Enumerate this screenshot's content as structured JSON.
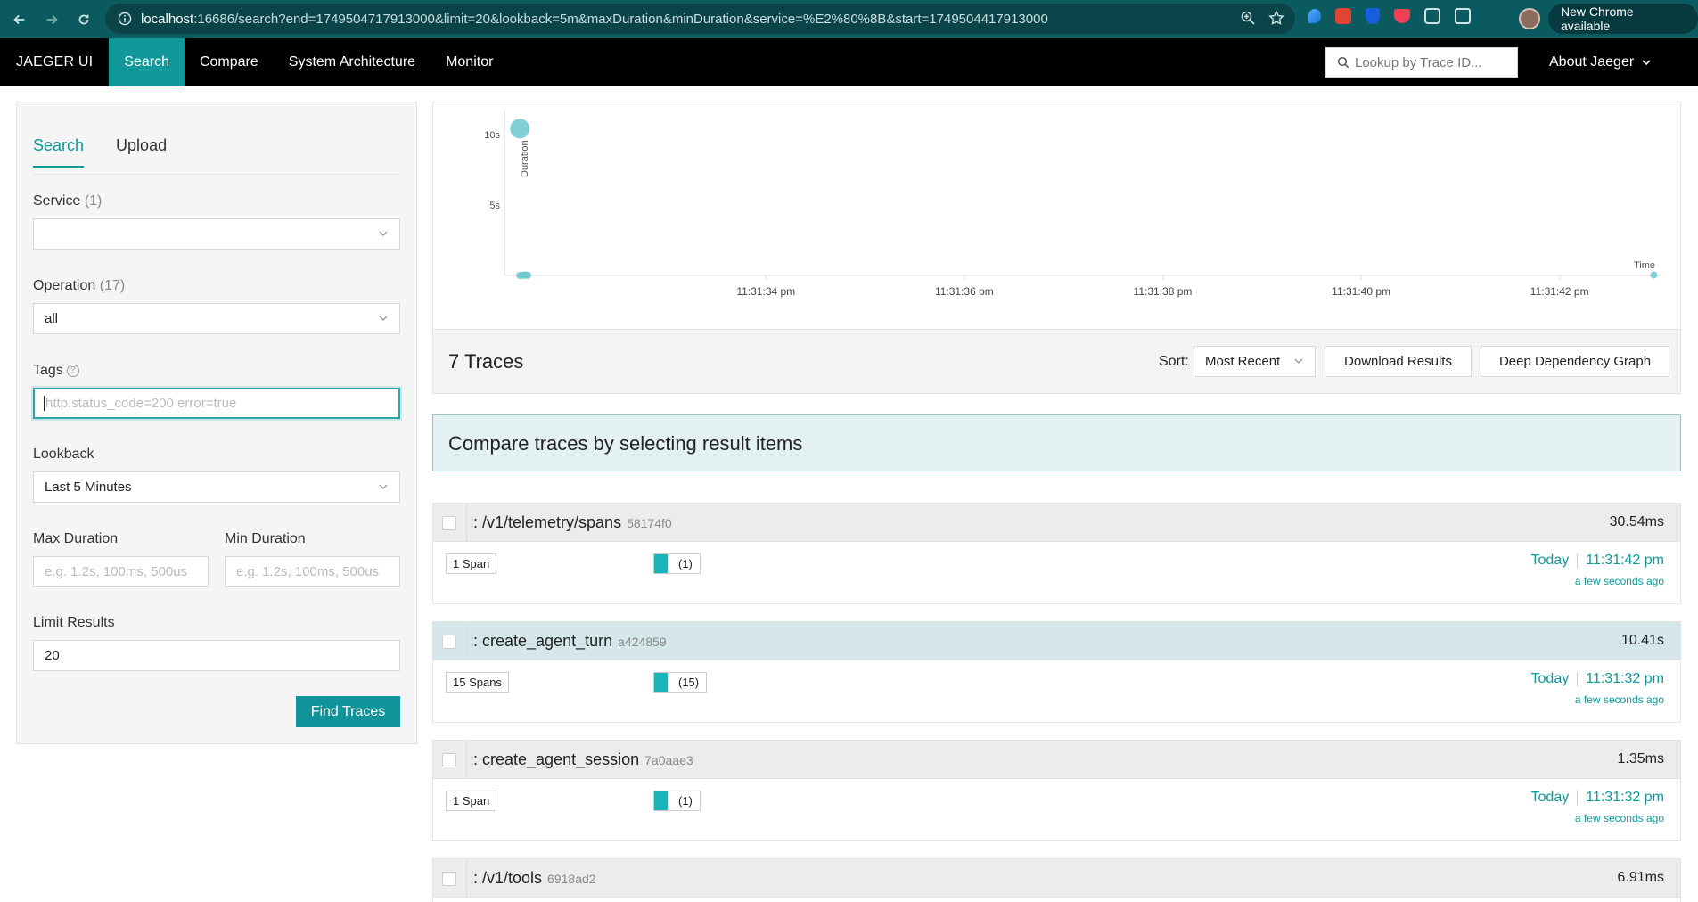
{
  "browser": {
    "url_host": "localhost",
    "url_rest": ":16686/search?end=1749504717913000&limit=20&lookback=5m&maxDuration&minDuration&service=%E2%80%8B&start=1749504417913000",
    "new_chrome": "New Chrome available"
  },
  "nav": {
    "brand": "JAEGER UI",
    "items": [
      "Search",
      "Compare",
      "System Architecture",
      "Monitor"
    ],
    "lookup_placeholder": "Lookup by Trace ID...",
    "about": "About Jaeger"
  },
  "search_form": {
    "tabs": [
      "Search",
      "Upload"
    ],
    "service_label": "Service",
    "service_count": "(1)",
    "service_value": "",
    "operation_label": "Operation",
    "operation_count": "(17)",
    "operation_value": "all",
    "tags_label": "Tags",
    "tags_placeholder": "http.status_code=200 error=true",
    "lookback_label": "Lookback",
    "lookback_value": "Last 5 Minutes",
    "max_duration_label": "Max Duration",
    "max_duration_placeholder": "e.g. 1.2s, 100ms, 500us",
    "min_duration_label": "Min Duration",
    "min_duration_placeholder": "e.g. 1.2s, 100ms, 500us",
    "limit_label": "Limit Results",
    "limit_value": "20",
    "find_button": "Find Traces"
  },
  "chart_data": {
    "type": "scatter",
    "ylabel": "Duration",
    "xlabel": "Time",
    "y_ticks": [
      "5s",
      "10s"
    ],
    "x_ticks": [
      "11:31:34 pm",
      "11:31:36 pm",
      "11:31:38 pm",
      "11:31:40 pm",
      "11:31:42 pm"
    ],
    "x_tick_values": [
      34,
      36,
      38,
      40,
      42
    ],
    "xlim": [
      31.5,
      43
    ],
    "ylim": [
      0,
      11
    ],
    "points": [
      {
        "x": 31.52,
        "y": 10.41
      },
      {
        "x": 31.52,
        "y": 0.00135
      },
      {
        "x": 31.55,
        "y": 0.00691
      },
      {
        "x": 31.56,
        "y": 0.02
      },
      {
        "x": 31.58,
        "y": 0.03
      },
      {
        "x": 31.6,
        "y": 0.01
      },
      {
        "x": 42.95,
        "y": 0.03054
      }
    ],
    "color": "#6cc8cc"
  },
  "results": {
    "count_label": "7 Traces",
    "sort_label": "Sort:",
    "sort_value": "Most Recent",
    "download_button": "Download Results",
    "ddg_button": "Deep Dependency Graph",
    "compare_banner": "Compare traces by selecting result items"
  },
  "traces": [
    {
      "title": ": /v1/telemetry/spans",
      "id": "58174f0",
      "duration": "30.54ms",
      "spans": "1 Span",
      "svc_count": "(1)",
      "day": "Today",
      "time": "11:31:42 pm",
      "ago": "a few seconds ago",
      "highlight": false
    },
    {
      "title": ": create_agent_turn",
      "id": "a424859",
      "duration": "10.41s",
      "spans": "15 Spans",
      "svc_count": "(15)",
      "day": "Today",
      "time": "11:31:32 pm",
      "ago": "a few seconds ago",
      "highlight": true
    },
    {
      "title": ": create_agent_session",
      "id": "7a0aae3",
      "duration": "1.35ms",
      "spans": "1 Span",
      "svc_count": "(1)",
      "day": "Today",
      "time": "11:31:32 pm",
      "ago": "a few seconds ago",
      "highlight": false
    },
    {
      "title": ": /v1/tools",
      "id": "6918ad2",
      "duration": "6.91ms",
      "highlight": false
    }
  ],
  "colors": {
    "accent": "#119999",
    "browser_bar": "#0b5a60",
    "span_swatch": "#19b3b8"
  }
}
